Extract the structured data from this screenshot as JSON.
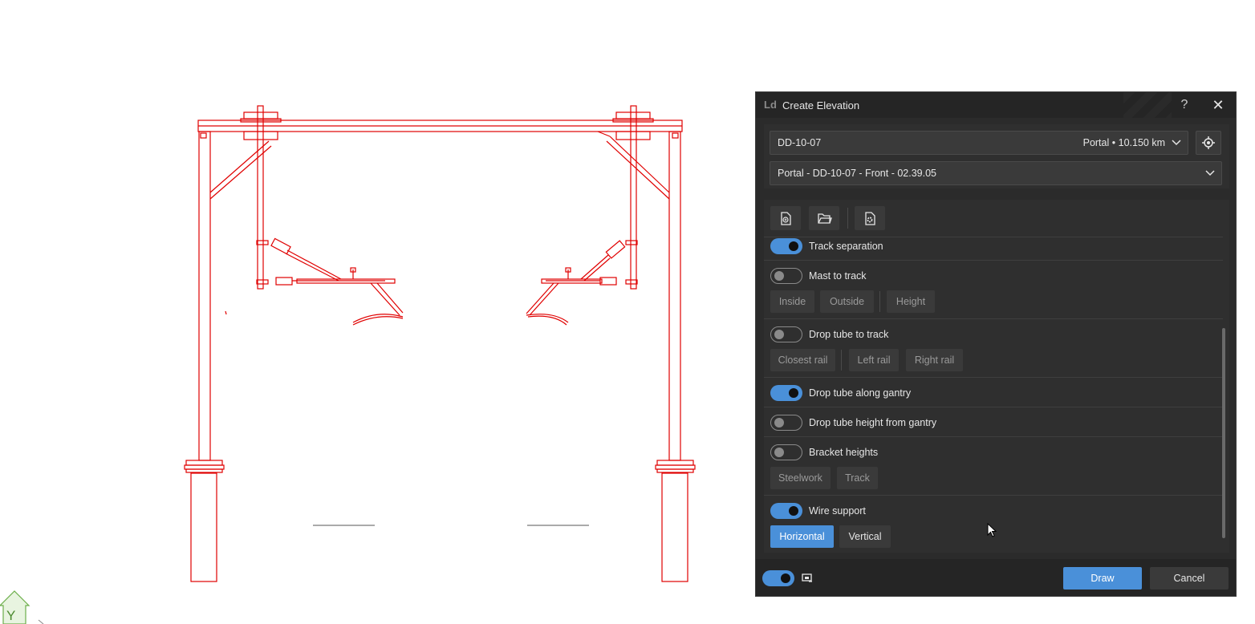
{
  "ucs": {
    "axis_label": "Y"
  },
  "dialog": {
    "logo": "Ld",
    "title": "Create Elevation",
    "help": "?",
    "close": "✕",
    "structure": {
      "id": "DD-10-07",
      "type": "Portal",
      "separator": "•",
      "chainage": "10.150 km"
    },
    "view": {
      "label": "Portal - DD-10-07 - Front - 02.39.05"
    },
    "toolbar": {
      "icons": [
        "new-file-icon",
        "open-folder-icon",
        "settings-file-icon"
      ]
    },
    "options": {
      "track_separation": {
        "label": "Track separation",
        "on": true
      },
      "mast_to_track": {
        "label": "Mast to track",
        "on": false,
        "buttons": [
          "Inside",
          "Outside",
          "Height"
        ]
      },
      "drop_tube_to_track": {
        "label": "Drop tube to track",
        "on": false,
        "buttons": [
          "Closest rail",
          "Left rail",
          "Right rail"
        ]
      },
      "drop_tube_along_gantry": {
        "label": "Drop tube along gantry",
        "on": true
      },
      "drop_tube_height_from_gantry": {
        "label": "Drop tube height from gantry",
        "on": false
      },
      "bracket_heights": {
        "label": "Bracket heights",
        "on": false,
        "buttons": [
          "Steelwork",
          "Track"
        ]
      },
      "wire_support": {
        "label": "Wire support",
        "on": true,
        "buttons": [
          "Horizontal",
          "Vertical"
        ],
        "selected": "Horizontal"
      }
    },
    "footer": {
      "toggle_on": true,
      "draw": "Draw",
      "cancel": "Cancel"
    }
  },
  "colors": {
    "accent": "#4a90d9",
    "drawing": "#e00000",
    "panel": "#2b2b2b"
  }
}
